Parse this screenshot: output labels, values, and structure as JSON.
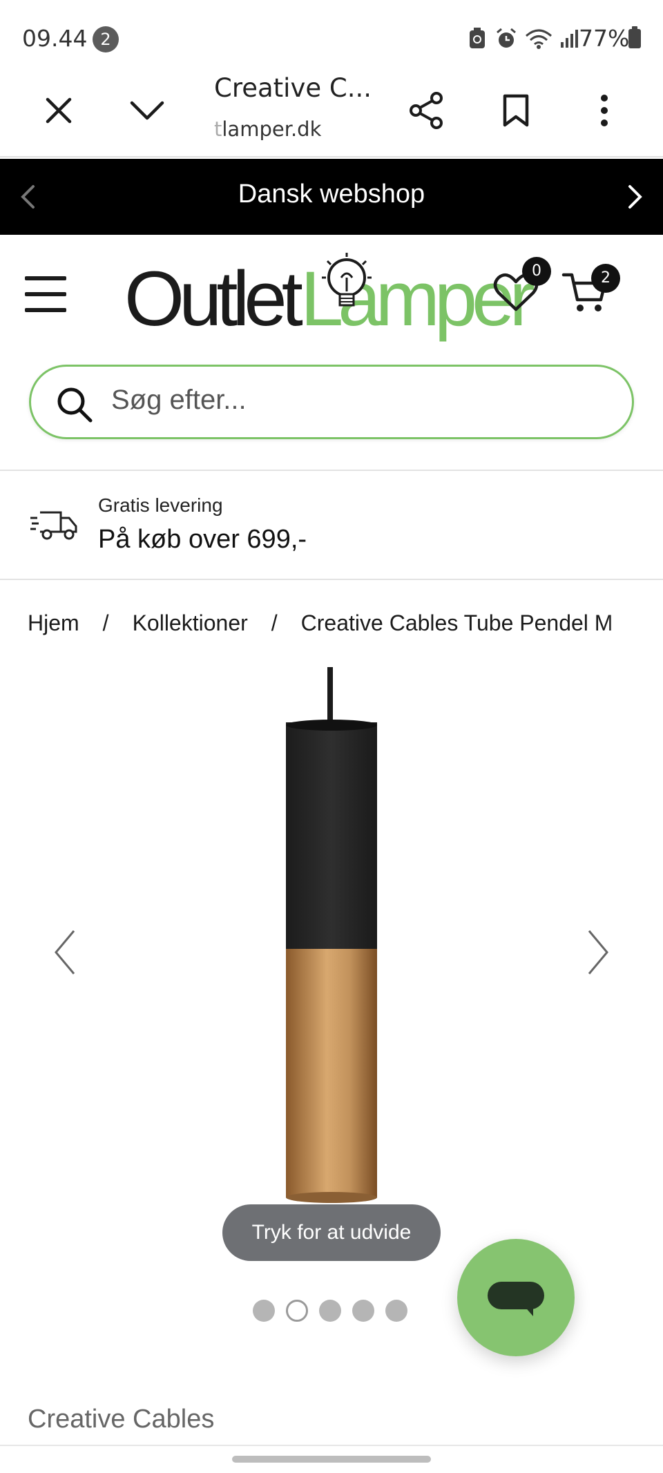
{
  "status_bar": {
    "time": "09.44",
    "notification_count": "2",
    "battery": "77%"
  },
  "browser": {
    "title": "Creative C...",
    "url_fade": "t",
    "url": "lamper.dk"
  },
  "announcement": {
    "text": "Dansk webshop"
  },
  "header": {
    "logo_part1": "Outlet",
    "logo_part2": "Lamper",
    "wishlist_count": "0",
    "cart_count": "2"
  },
  "search": {
    "placeholder": "Søg efter..."
  },
  "delivery": {
    "line1": "Gratis levering",
    "line2": "På køb over 699,-"
  },
  "breadcrumb": {
    "items": [
      "Hjem",
      "Kollektioner",
      "Creative Cables Tube Pendel M"
    ],
    "separator": "/"
  },
  "gallery": {
    "expand_hint": "Tryk for at udvide",
    "dot_count": 5,
    "active_dot": 1
  },
  "product": {
    "brand": "Creative Cables"
  },
  "colors": {
    "accent_green": "#7cc366",
    "chat_green": "#86c470",
    "announcement_bg": "#000000",
    "copper": "#c89a63"
  }
}
